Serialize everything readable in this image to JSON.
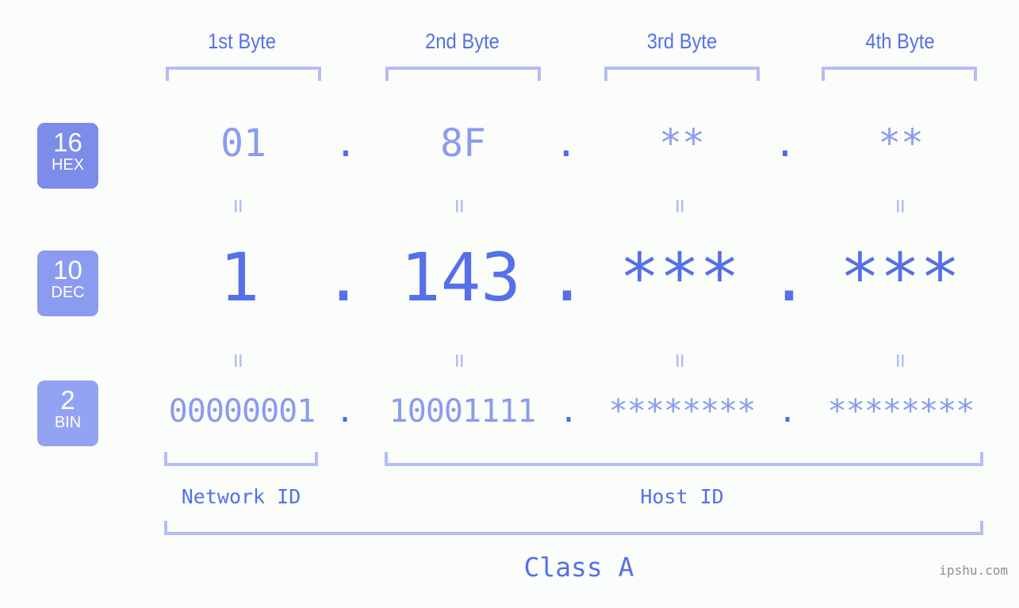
{
  "columns": [
    {
      "title": "1st Byte",
      "hex": "01",
      "dec": "1",
      "bin": "00000001"
    },
    {
      "title": "2nd Byte",
      "hex": "8F",
      "dec": "143",
      "bin": "10001111"
    },
    {
      "title": "3rd Byte",
      "hex": "**",
      "dec": "***",
      "bin": "********"
    },
    {
      "title": "4th Byte",
      "hex": "**",
      "dec": "***",
      "bin": "********"
    }
  ],
  "separators": {
    "dot": ".",
    "equals": "="
  },
  "radix_badges": [
    {
      "number": "16",
      "name": "HEX"
    },
    {
      "number": "10",
      "name": "DEC"
    },
    {
      "number": "2",
      "name": "BIN"
    }
  ],
  "footer": {
    "network_id": "Network ID",
    "host_id": "Host ID",
    "class": "Class A",
    "watermark": "ipshu.com"
  },
  "colors": {
    "background": "#fbfdfa",
    "accent_strong": "#5570e8",
    "accent_mid": "#8b9bef",
    "accent_light": "#b3bdf7",
    "badge_hex": "#7b8ceb",
    "badge_dec": "#8b9bef",
    "badge_bin": "#93a3f3",
    "watermark": "#8d8d8d"
  }
}
